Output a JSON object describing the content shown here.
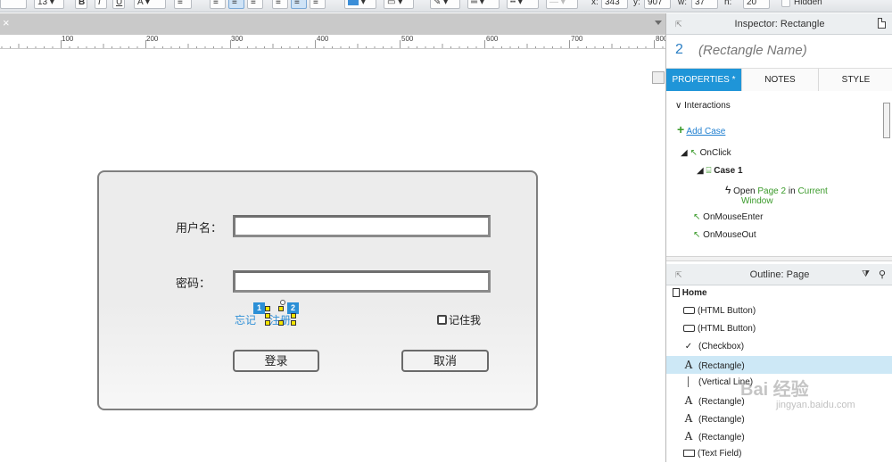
{
  "toolbar": {
    "font_size": "13",
    "x_label": "x:",
    "x_value": "343",
    "y_label": "y:",
    "y_value": "907",
    "w_label": "w:",
    "w_value": "37",
    "h_label": "h:",
    "h_value": "20",
    "hidden_label": "Hidden",
    "fill_color": "#3b8ed8"
  },
  "canvas": {
    "close_glyph": "×",
    "ruler": [
      "100",
      "200",
      "300",
      "400",
      "500",
      "600",
      "700",
      "800"
    ],
    "form": {
      "username_label": "用户名：",
      "password_label": "密码：",
      "forgot_link": "忘记",
      "register_link": "注册",
      "remember_label": "记住我",
      "login_button": "登录",
      "cancel_button": "取消",
      "marker1": "1",
      "marker2": "2"
    }
  },
  "inspector": {
    "title": "Inspector: Rectangle",
    "number": "2",
    "name": "(Rectangle Name)",
    "tabs": {
      "properties": "PROPERTIES",
      "properties_mark": "*",
      "notes": "NOTES",
      "style": "STYLE"
    },
    "section": "Interactions",
    "add_case": "Add Case",
    "onclick": "OnClick",
    "case1": "Case 1",
    "action_open": "Open",
    "action_page": "Page 2",
    "action_in": "in",
    "action_current": "Current",
    "action_window": "Window",
    "onmouseenter": "OnMouseEnter",
    "onmouseout": "OnMouseOut"
  },
  "outline": {
    "title": "Outline: Page",
    "items": [
      {
        "label": "Home"
      },
      {
        "label": "(HTML Button)"
      },
      {
        "label": "(HTML Button)"
      },
      {
        "label": "(Checkbox)"
      },
      {
        "label": "(Rectangle)"
      },
      {
        "label": "(Vertical Line)"
      },
      {
        "label": "(Rectangle)"
      },
      {
        "label": "(Rectangle)"
      },
      {
        "label": "(Rectangle)"
      },
      {
        "label": "(Text Field)"
      }
    ]
  },
  "watermark": {
    "text": "Bai 经验",
    "sub": "jingyan.baidu.com"
  }
}
